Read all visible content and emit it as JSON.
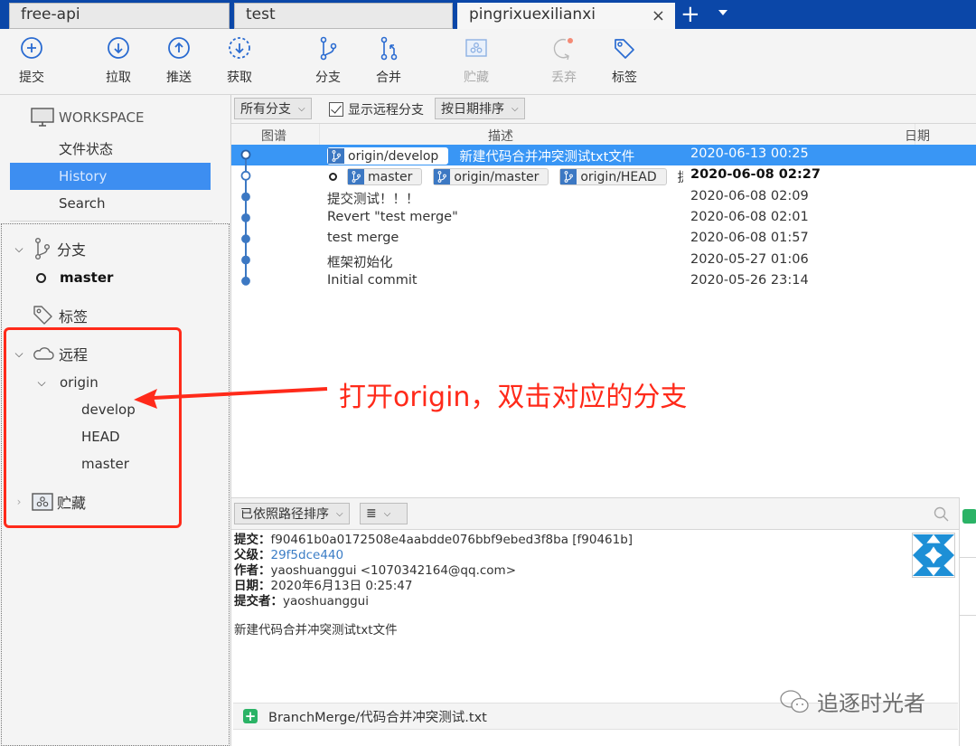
{
  "tabs": [
    {
      "label": "free-api",
      "active": false
    },
    {
      "label": "test",
      "active": false
    },
    {
      "label": "pingrixuexilianxi",
      "active": true
    }
  ],
  "tab_close": "×",
  "tab_add": "+",
  "toolbar": {
    "commit": "提交",
    "pull": "拉取",
    "push": "推送",
    "fetch": "获取",
    "branch": "分支",
    "merge": "合并",
    "stash": "贮藏",
    "discard": "丢弃",
    "tag": "标签"
  },
  "sidebar": {
    "workspace": "WORKSPACE",
    "workspace_items": [
      {
        "label": "文件状态",
        "selected": false
      },
      {
        "label": "History",
        "selected": true
      },
      {
        "label": "Search",
        "selected": false
      }
    ],
    "branches_header": "分支",
    "branches": [
      "master"
    ],
    "tags_header": "标签",
    "remotes_header": "远程",
    "remote_name": "origin",
    "remote_branches": [
      "develop",
      "HEAD",
      "master"
    ],
    "stash_header": "贮藏"
  },
  "annotation": {
    "text": "打开origin，双击对应的分支",
    "color": "#ff2a1a"
  },
  "filters": {
    "branch_filter": "所有分支",
    "show_remote": "显示远程分支",
    "show_remote_checked": true,
    "sort": "按日期排序"
  },
  "columns": {
    "graph": "图谱",
    "description": "描述",
    "date": "日期"
  },
  "commits": [
    {
      "badges": [
        "origin/develop"
      ],
      "head": false,
      "message": "新建代码合并冲突测试txt文件",
      "date": "2020-06-13 00:25",
      "selected": true
    },
    {
      "badges": [
        "master",
        "origin/master",
        "origin/HEAD"
      ],
      "head": true,
      "message": "提交测试！！！",
      "date": "2020-06-08 02:27",
      "selected": false
    },
    {
      "badges": [],
      "head": false,
      "message": "提交测试！！！",
      "date": "2020-06-08 02:09",
      "selected": false
    },
    {
      "badges": [],
      "head": false,
      "message": "Revert \"test merge\"",
      "date": "2020-06-08 02:01",
      "selected": false
    },
    {
      "badges": [],
      "head": false,
      "message": "test merge",
      "date": "2020-06-08 01:57",
      "selected": false
    },
    {
      "badges": [],
      "head": false,
      "message": "框架初始化",
      "date": "2020-05-27 01:06",
      "selected": false
    },
    {
      "badges": [],
      "head": false,
      "message": "Initial commit",
      "date": "2020-05-26 23:14",
      "selected": false
    }
  ],
  "detail_bar": {
    "sort": "已依照路径排序",
    "view_icon": "≣"
  },
  "detail": {
    "commit_label": "提交：",
    "commit_value": "f90461b0a0172508e4aabdde076bbf9ebed3f8ba [f90461b]",
    "parent_label": "父级：",
    "parent_value": "29f5dce440",
    "author_label": "作者：",
    "author_value": "yaoshuanggui <1070342164@qq.com>",
    "date_label": "日期：",
    "date_value": "2020年6月13日 0:25:47",
    "committer_label": "提交者：",
    "committer_value": "yaoshuanggui",
    "message": "新建代码合并冲突测试txt文件"
  },
  "files": [
    {
      "status": "added",
      "path": "BranchMerge/代码合并冲突测试.txt"
    }
  ],
  "watermark": "追逐时光者",
  "colors": {
    "accent": "#3d8ef1",
    "selected_row": "#3996f5",
    "tab_bar": "#0b47a8",
    "badge_icon": "#3c78c3",
    "added": "#2bb366"
  }
}
